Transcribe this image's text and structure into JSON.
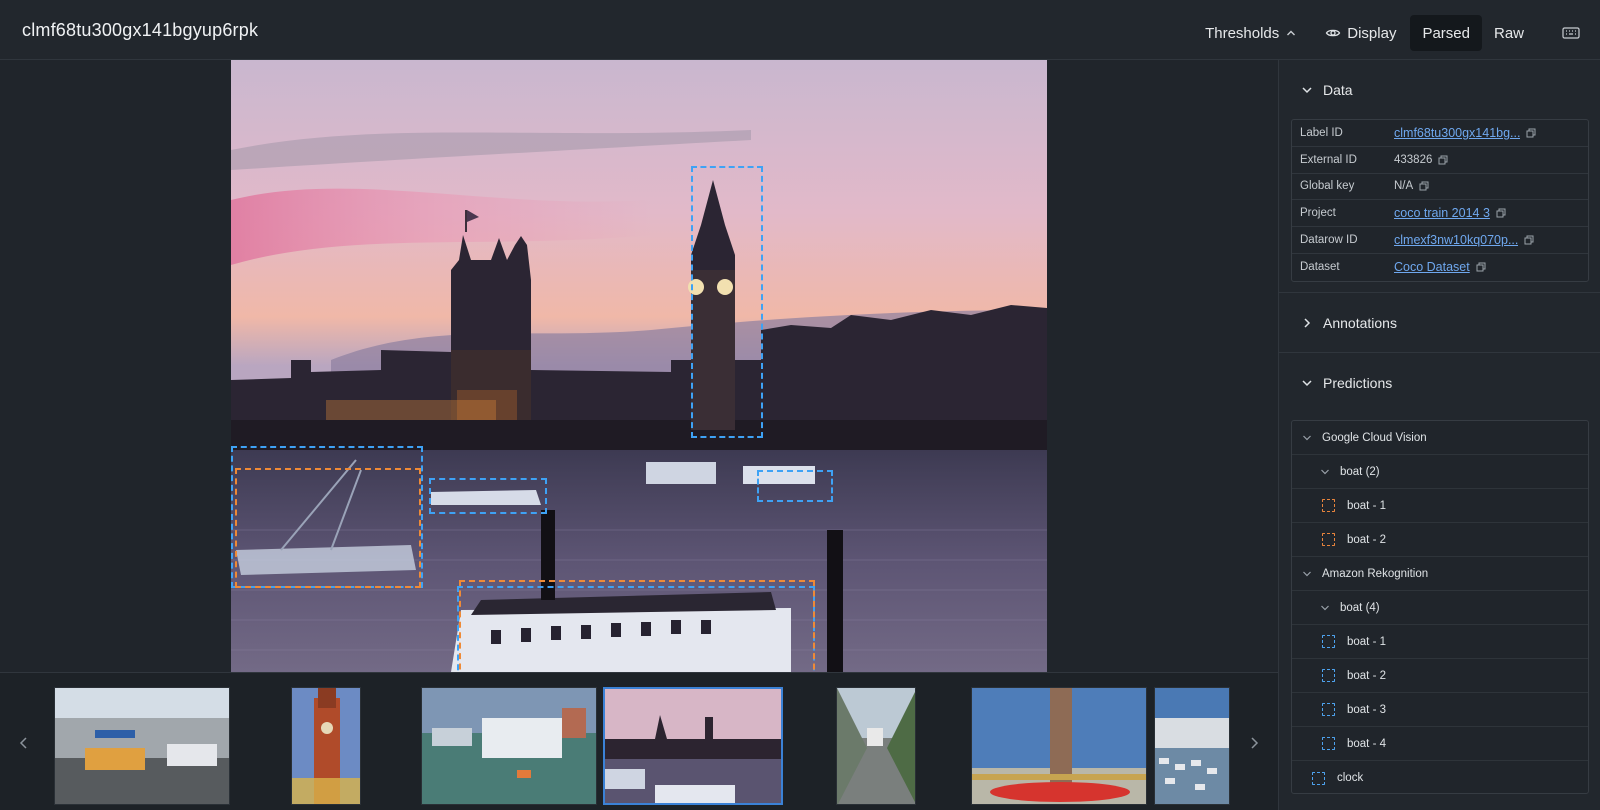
{
  "header": {
    "title": "clmf68tu300gx141bgyup6rpk",
    "thresholds_label": "Thresholds",
    "display_label": "Display",
    "parsed_label": "Parsed",
    "raw_label": "Raw"
  },
  "sidebar": {
    "data_section": "Data",
    "annotations_section": "Annotations",
    "predictions_section": "Predictions",
    "data_rows": [
      {
        "key": "Label ID",
        "value": "clmf68tu300gx141bg...",
        "link": true
      },
      {
        "key": "External ID",
        "value": "433826",
        "link": false
      },
      {
        "key": "Global key",
        "value": "N/A",
        "link": false
      },
      {
        "key": "Project",
        "value": "coco train 2014 3",
        "link": true
      },
      {
        "key": "Datarow ID",
        "value": "clmexf3nw10kq070p...",
        "link": true
      },
      {
        "key": "Dataset",
        "value": "Coco Dataset",
        "link": true
      }
    ],
    "predictions": [
      {
        "label": "Google Cloud Vision"
      },
      {
        "label": "boat (2)"
      },
      {
        "label": "boat - 1"
      },
      {
        "label": "boat - 2"
      },
      {
        "label": "Amazon Rekognition"
      },
      {
        "label": "boat (4)"
      },
      {
        "label": "boat - 1"
      },
      {
        "label": "boat - 2"
      },
      {
        "label": "boat - 3"
      },
      {
        "label": "boat - 4"
      },
      {
        "label": "clock"
      }
    ]
  },
  "colors": {
    "accent_blue": "#3ea2f5",
    "accent_orange": "#ef8a36",
    "link": "#6fa8ef",
    "selected_border": "#3b82d6"
  },
  "icons": {
    "thresholds": "chevron-up-icon",
    "display": "eye-icon",
    "keyboard": "keyboard-icon",
    "copy": "copy-icon",
    "filmstrip_prev": "chevron-left-icon",
    "filmstrip_next": "chevron-right-icon"
  }
}
